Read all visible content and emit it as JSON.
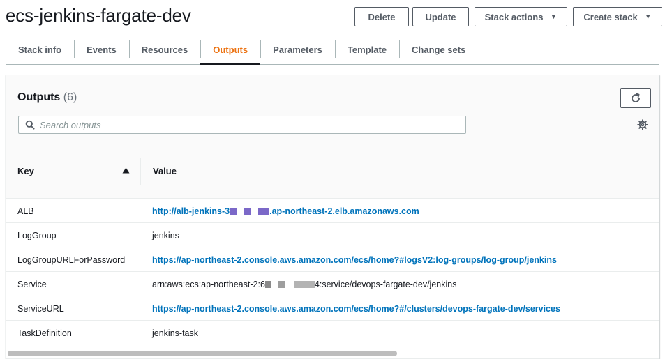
{
  "header": {
    "title": "ecs-jenkins-fargate-dev",
    "buttons": {
      "delete": "Delete",
      "update": "Update",
      "stack_actions": "Stack actions",
      "create_stack": "Create stack"
    }
  },
  "tabs": [
    {
      "label": "Stack info"
    },
    {
      "label": "Events"
    },
    {
      "label": "Resources"
    },
    {
      "label": "Outputs",
      "active": true
    },
    {
      "label": "Parameters"
    },
    {
      "label": "Template"
    },
    {
      "label": "Change sets"
    }
  ],
  "outputs": {
    "title": "Outputs",
    "count": "(6)",
    "search_placeholder": "Search outputs",
    "columns": {
      "key": "Key",
      "value": "Value"
    },
    "rows": [
      {
        "key": "ALB",
        "value_parts": [
          "http://alb-jenkins-3",
          ".ap-northeast-2.elb.amazonaws.com"
        ],
        "link": true
      },
      {
        "key": "LogGroup",
        "value": "jenkins",
        "link": false
      },
      {
        "key": "LogGroupURLForPassword",
        "value": "https://ap-northeast-2.console.aws.amazon.com/ecs/home?#logsV2:log-groups/log-group/jenkins",
        "link": true
      },
      {
        "key": "Service",
        "value_parts": [
          "arn:aws:ecs:ap-northeast-2:6",
          "4:service/devops-fargate-dev/jenkins"
        ],
        "link": false
      },
      {
        "key": "ServiceURL",
        "value": "https://ap-northeast-2.console.aws.amazon.com/ecs/home?#/clusters/devops-fargate-dev/services",
        "link": true
      },
      {
        "key": "TaskDefinition",
        "value": "jenkins-task",
        "link": false
      }
    ]
  },
  "colors": {
    "active_tab": "#ec7211",
    "link": "#0073bb",
    "redact_alb": "#7b68c8",
    "redact_service": "#9e9e9e"
  },
  "icons": {
    "refresh": "refresh-icon",
    "search": "search-icon",
    "settings": "gear-icon",
    "sort": "sort-ascending-icon",
    "dropdown": "caret-down-icon"
  }
}
